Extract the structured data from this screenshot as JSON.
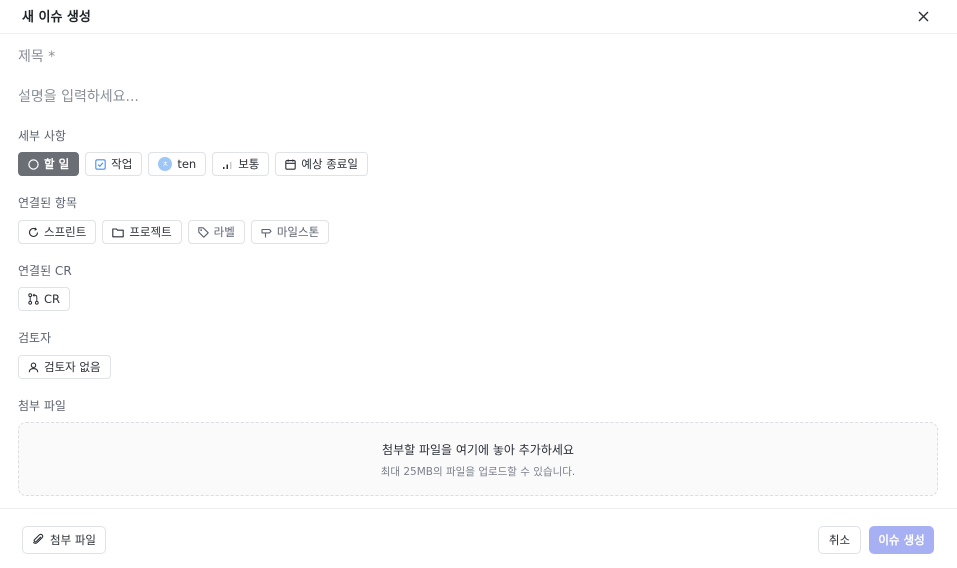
{
  "dialog": {
    "title": "새 이슈 생성"
  },
  "form": {
    "title_placeholder": "제목 *",
    "description_placeholder": "설명을 입력하세요..."
  },
  "details": {
    "label": "세부 사항",
    "status": "할 일",
    "type": "작업",
    "assignee": "ten",
    "assignee_initial": "ㅊ",
    "priority": "보통",
    "due_date": "예상 종료일"
  },
  "linked": {
    "label": "연결된 항목",
    "sprint": "스프린트",
    "project": "프로젝트",
    "label_chip": "라벨",
    "milestone": "마일스톤"
  },
  "linked_cr": {
    "label": "연결된 CR",
    "cr": "CR"
  },
  "reviewer": {
    "label": "검토자",
    "none": "검토자 없음"
  },
  "attachments": {
    "label": "첨부 파일",
    "drop_main": "첨부할 파일을 여기에 놓아 추가하세요",
    "drop_sub": "최대 25MB의 파일을 업로드할 수 있습니다."
  },
  "footer": {
    "attach_label": "첨부 파일",
    "cancel_label": "취소",
    "create_label": "이슈 생성"
  },
  "colors": {
    "status_chip": "#6b6f75",
    "create_button": "#a7b0f2",
    "type_icon": "#4a8cf0",
    "avatar": "#9ec7f5"
  },
  "icons": {
    "close": "close-icon",
    "status": "circle-icon",
    "type": "checkbox-icon",
    "priority": "signal-bars-icon",
    "due_date": "calendar-icon",
    "sprint": "refresh-icon",
    "project": "folder-icon",
    "label": "tag-icon",
    "milestone": "signpost-icon",
    "cr": "git-pull-request-icon",
    "reviewer": "user-icon",
    "attach": "paperclip-icon"
  }
}
